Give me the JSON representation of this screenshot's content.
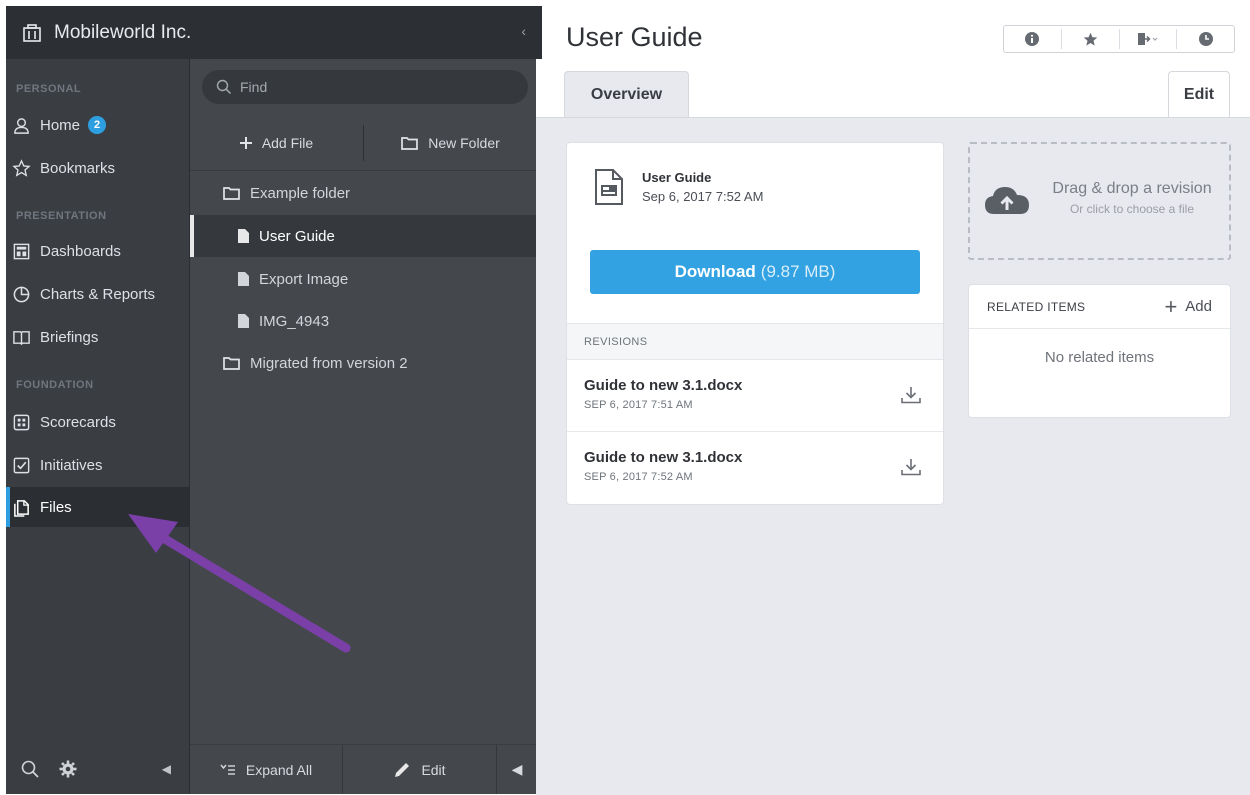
{
  "org": {
    "name": "Mobileworld Inc.",
    "collapse_icon": "chevron-left-icon"
  },
  "sidebar": {
    "sections": [
      {
        "label": "PERSONAL"
      },
      {
        "label": "PRESENTATION"
      },
      {
        "label": "FOUNDATION"
      }
    ],
    "items": [
      {
        "label": "Home",
        "icon": "person-icon",
        "badge": "2"
      },
      {
        "label": "Bookmarks",
        "icon": "star-icon"
      },
      {
        "label": "Dashboards",
        "icon": "dashboard-icon"
      },
      {
        "label": "Charts & Reports",
        "icon": "pie-chart-icon"
      },
      {
        "label": "Briefings",
        "icon": "book-icon"
      },
      {
        "label": "Scorecards",
        "icon": "scorecard-icon"
      },
      {
        "label": "Initiatives",
        "icon": "checkbox-icon"
      },
      {
        "label": "Files",
        "icon": "files-icon",
        "active": true
      }
    ]
  },
  "filepanel": {
    "search_placeholder": "Find",
    "add_file": "Add File",
    "new_folder": "New Folder",
    "tree": [
      {
        "label": "Example folder",
        "type": "folder"
      },
      {
        "label": "User Guide",
        "type": "file",
        "selected": true
      },
      {
        "label": "Export Image",
        "type": "file"
      },
      {
        "label": "IMG_4943",
        "type": "file"
      },
      {
        "label": "Migrated from version 2",
        "type": "folder"
      }
    ],
    "expand_all": "Expand All",
    "edit": "Edit"
  },
  "main": {
    "title": "User Guide",
    "tabs": {
      "overview": "Overview",
      "edit": "Edit"
    },
    "file": {
      "name": "User Guide",
      "date": "Sep 6, 2017 7:52 AM",
      "download_label": "Download",
      "download_size": "(9.87 MB)"
    },
    "revisions": {
      "header": "REVISIONS",
      "items": [
        {
          "name": "Guide to new 3.1.docx",
          "date": "SEP 6, 2017 7:51 AM"
        },
        {
          "name": "Guide to new 3.1.docx",
          "date": "SEP 6, 2017 7:52 AM"
        }
      ]
    },
    "dropzone": {
      "title": "Drag & drop a revision",
      "subtitle": "Or click to choose a file"
    },
    "related": {
      "header": "RELATED ITEMS",
      "add": "Add",
      "empty": "No related items"
    }
  },
  "colors": {
    "accent": "#2d9ee0",
    "download": "#32a2e2",
    "annotation_arrow": "#7b3fa8"
  }
}
